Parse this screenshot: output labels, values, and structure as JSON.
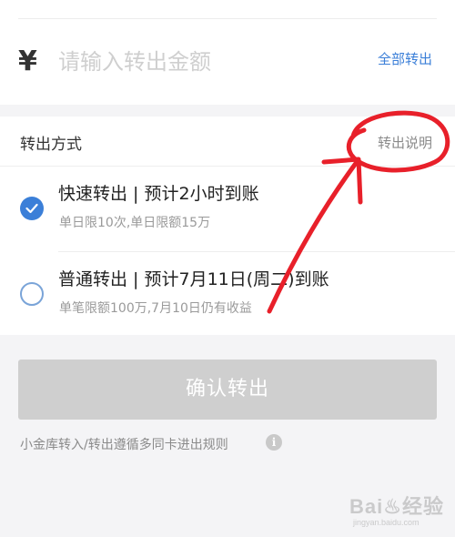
{
  "amount": {
    "currency_symbol": "¥",
    "placeholder": "请输入转出金额",
    "value": "",
    "all_out_label": "全部转出"
  },
  "method": {
    "title": "转出方式",
    "help_label": "转出说明",
    "options": [
      {
        "title": "快速转出 | 预计2小时到账",
        "subtitle": "单日限10次,单日限额15万",
        "selected": true
      },
      {
        "title": "普通转出 | 预计7月11日(周二)到账",
        "subtitle": "单笔限额100万,7月10日仍有收益",
        "selected": false
      }
    ]
  },
  "confirm_button_label": "确认转出",
  "rules_text": "小金库转入/转出遵循多同卡进出规则",
  "info_icon_glyph": "i",
  "watermark": {
    "main": "Bai♨经验",
    "sub": "jingyan.baidu.com"
  },
  "colors": {
    "accent": "#3b7fd8",
    "annotation": "#e8202a",
    "disabled_button": "#cfcfcf"
  }
}
